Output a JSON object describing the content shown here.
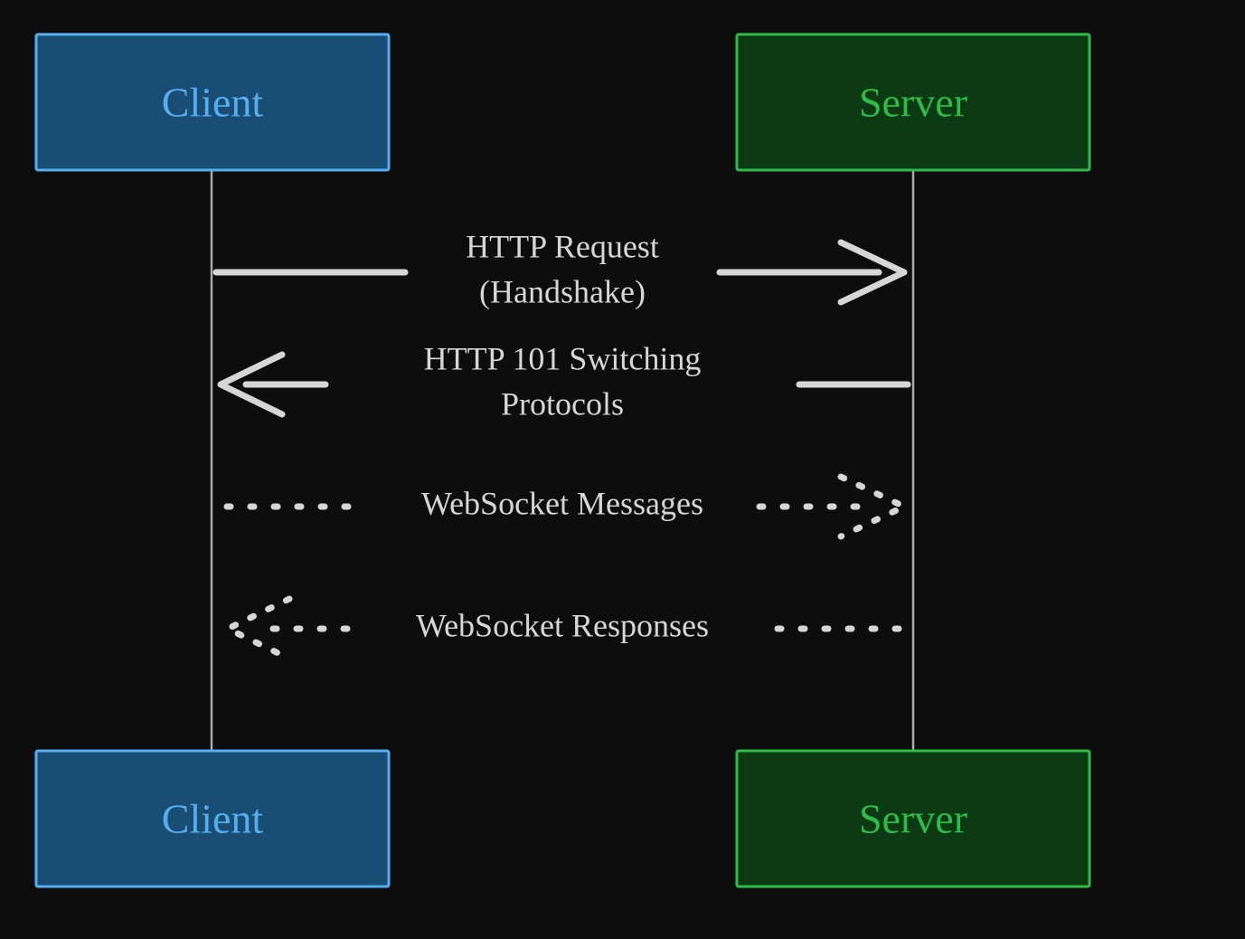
{
  "diagram": {
    "type": "sequence",
    "participants": {
      "client": {
        "label_top": "Client",
        "label_bottom": "Client",
        "color": "#56aef0",
        "fill": "#1a4d73"
      },
      "server": {
        "label_top": "Server",
        "label_bottom": "Server",
        "color": "#2fbb4a",
        "fill": "#0b3a13"
      }
    },
    "messages": [
      {
        "from": "client",
        "to": "server",
        "style": "solid",
        "line1": "HTTP Request",
        "line2": "(Handshake)"
      },
      {
        "from": "server",
        "to": "client",
        "style": "solid",
        "line1": "HTTP 101 Switching",
        "line2": "Protocols"
      },
      {
        "from": "client",
        "to": "server",
        "style": "dashed",
        "line1": "WebSocket Messages",
        "line2": ""
      },
      {
        "from": "server",
        "to": "client",
        "style": "dashed",
        "line1": "WebSocket Responses",
        "line2": ""
      }
    ]
  }
}
